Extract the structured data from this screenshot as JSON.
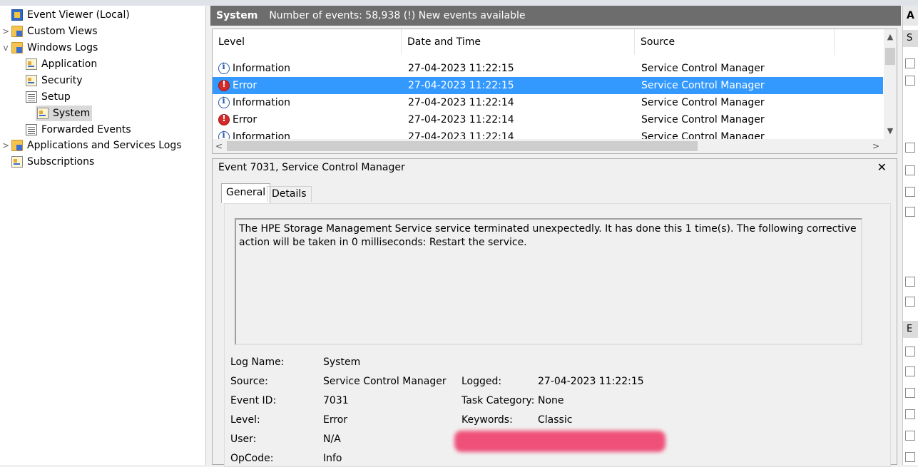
{
  "tree": {
    "root": "Event Viewer (Local)",
    "custom_views": "Custom Views",
    "windows_logs": "Windows Logs",
    "application": "Application",
    "security": "Security",
    "setup": "Setup",
    "system": "System",
    "forwarded": "Forwarded Events",
    "apps_services": "Applications and Services Logs",
    "subscriptions": "Subscriptions",
    "expand_glyph": ">",
    "collapse_glyph": "v"
  },
  "header": {
    "title": "System",
    "status": "Number of events: 58,938 (!) New events available"
  },
  "grid": {
    "columns": [
      "Level",
      "Date and Time",
      "Source"
    ],
    "rows": [
      {
        "level": "Information",
        "type": "info",
        "datetime": "27-04-2023 11:22:15",
        "source": "Service Control Manager",
        "selected": false
      },
      {
        "level": "Error",
        "type": "err",
        "datetime": "27-04-2023 11:22:15",
        "source": "Service Control Manager",
        "selected": true
      },
      {
        "level": "Information",
        "type": "info",
        "datetime": "27-04-2023 11:22:14",
        "source": "Service Control Manager",
        "selected": false
      },
      {
        "level": "Error",
        "type": "err",
        "datetime": "27-04-2023 11:22:14",
        "source": "Service Control Manager",
        "selected": false
      },
      {
        "level": "Information",
        "type": "info",
        "datetime": "27-04-2023 11:22:14",
        "source": "Service Control Manager",
        "selected": false
      }
    ]
  },
  "detail": {
    "title": "Event 7031, Service Control Manager",
    "close": "✕",
    "tabs": [
      "General",
      "Details"
    ],
    "description": "The HPE Storage Management Service service terminated unexpectedly.  It has done this 1 time(s).  The following corrective action will be taken in 0 milliseconds: Restart the service.",
    "props": {
      "log_name_label": "Log Name:",
      "log_name": "System",
      "source_label": "Source:",
      "source": "Service Control Manager",
      "logged_label": "Logged:",
      "logged": "27-04-2023 11:22:15",
      "event_id_label": "Event ID:",
      "event_id": "7031",
      "task_cat_label": "Task Category:",
      "task_cat": "None",
      "level_label": "Level:",
      "level": "Error",
      "keywords_label": "Keywords:",
      "keywords": "Classic",
      "user_label": "User:",
      "user": "N/A",
      "opcode_label": "OpCode:",
      "opcode": "Info"
    }
  },
  "actions": {
    "head": "A",
    "sub1": "S",
    "sub2": "E"
  }
}
